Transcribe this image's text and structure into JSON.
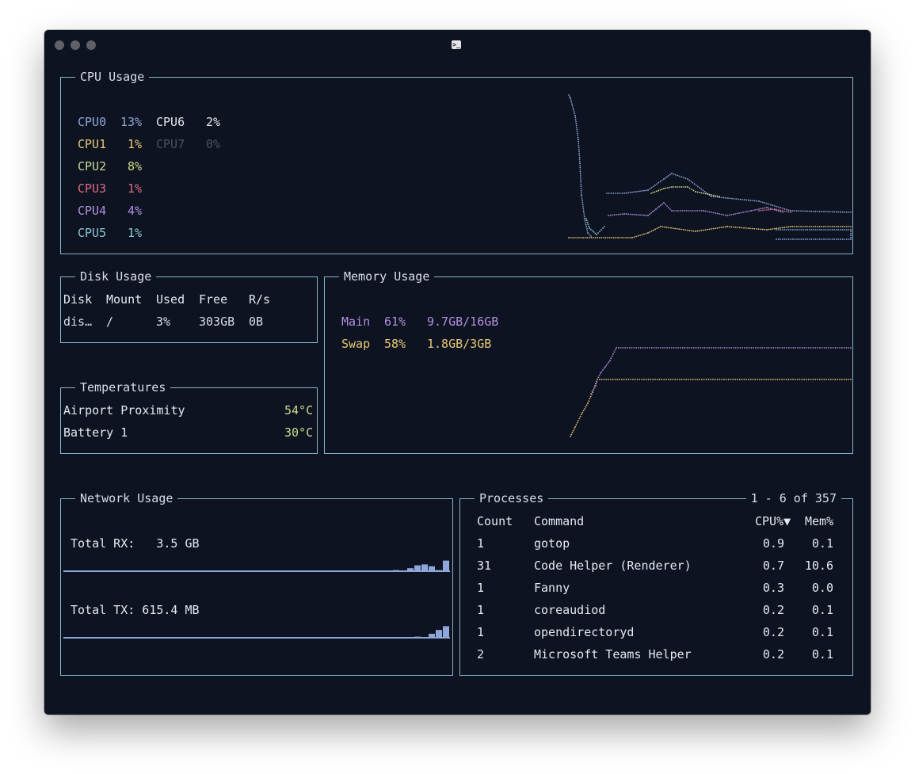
{
  "window": {
    "title_icon": "terminal-icon",
    "traffic_lights": [
      "close",
      "minimize",
      "zoom"
    ]
  },
  "cpu": {
    "title": "CPU Usage",
    "cores": [
      {
        "name": "CPU0",
        "value": "13%",
        "color": "#8fa6d8"
      },
      {
        "name": "CPU1",
        "value": "1%",
        "color": "#e8c874"
      },
      {
        "name": "CPU2",
        "value": "8%",
        "color": "#c9dc8e"
      },
      {
        "name": "CPU3",
        "value": "1%",
        "color": "#e06c84"
      },
      {
        "name": "CPU4",
        "value": "4%",
        "color": "#b390e0"
      },
      {
        "name": "CPU5",
        "value": "1%",
        "color": "#8cc7d0"
      },
      {
        "name": "CPU6",
        "value": "2%",
        "color": "#e5e9f0"
      },
      {
        "name": "CPU7",
        "value": "0%",
        "color": "#4b5263"
      }
    ]
  },
  "disk": {
    "title": "Disk Usage",
    "headers": [
      "Disk",
      "Mount",
      "Used",
      "Free",
      "R/s"
    ],
    "rows": [
      [
        "dis…",
        "/",
        "3%",
        "303GB",
        "0B"
      ]
    ]
  },
  "memory": {
    "title": "Memory Usage",
    "main": {
      "label": "Main",
      "percent": "61%",
      "amount": "9.7GB/16GB",
      "color": "#b390e0"
    },
    "swap": {
      "label": "Swap",
      "percent": "58%",
      "amount": "1.8GB/3GB",
      "color": "#e8c874"
    }
  },
  "temperatures": {
    "title": "Temperatures",
    "items": [
      {
        "name": "Airport Proximity",
        "value": "54°C"
      },
      {
        "name": "Battery 1",
        "value": "30°C"
      }
    ],
    "value_color": "#c9dc8e"
  },
  "network": {
    "title": "Network Usage",
    "rx_label": "Total RX:   3.5 GB",
    "tx_label": "Total TX: 615.4 MB",
    "rx_sparkline": [
      0.1,
      0.05,
      0.2,
      0.35,
      0.4,
      0.3,
      0.1,
      0.6
    ],
    "tx_sparkline": [
      0.1,
      0.05,
      0.25,
      0.45,
      0.65
    ]
  },
  "processes": {
    "title": "Processes",
    "range": "1 - 6 of 357",
    "headers": [
      "Count",
      "Command",
      "CPU%▼",
      "Mem%"
    ],
    "rows": [
      [
        "1",
        "gotop",
        "0.9",
        "0.1"
      ],
      [
        "31",
        "Code Helper (Renderer)",
        "0.7",
        "10.6"
      ],
      [
        "1",
        "Fanny",
        "0.3",
        "0.0"
      ],
      [
        "1",
        "coreaudiod",
        "0.2",
        "0.1"
      ],
      [
        "1",
        "opendirectoryd",
        "0.2",
        "0.1"
      ],
      [
        "2",
        "Microsoft Teams Helper",
        "0.2",
        "0.1"
      ]
    ]
  }
}
